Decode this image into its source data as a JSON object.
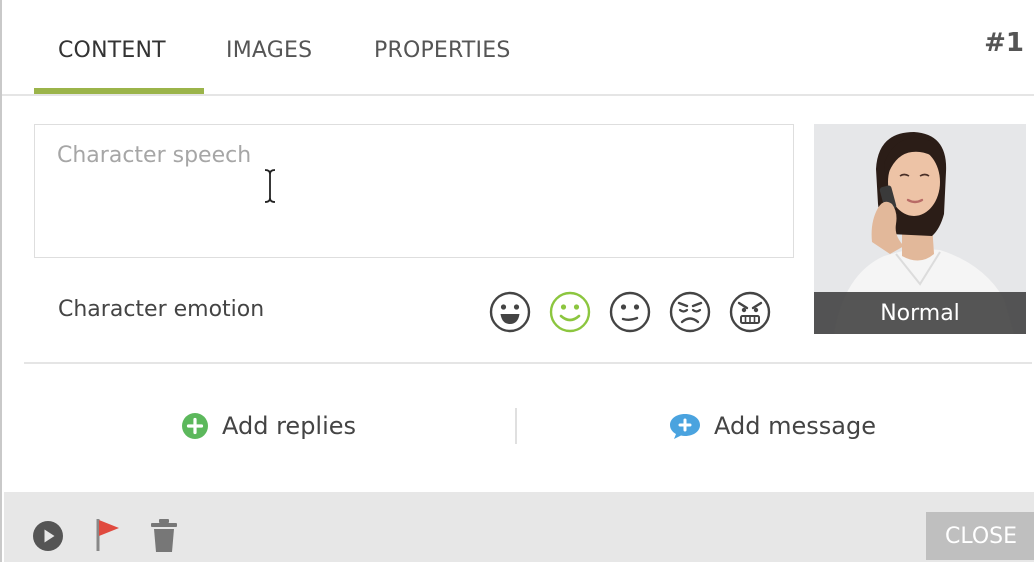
{
  "tabs": [
    {
      "label": "CONTENT",
      "active": true
    },
    {
      "label": "IMAGES",
      "active": false
    },
    {
      "label": "PROPERTIES",
      "active": false
    }
  ],
  "item_number": "#1",
  "speech": {
    "placeholder": "Character speech",
    "value": ""
  },
  "emotion": {
    "label": "Character emotion",
    "options": [
      "happy",
      "smile",
      "neutral",
      "sad",
      "angry"
    ],
    "selected": "smile",
    "selected_color": "#8cc63f",
    "default_color": "#444444"
  },
  "character": {
    "caption": "Normal"
  },
  "actions": {
    "add_replies": "Add replies",
    "add_message": "Add message"
  },
  "colors": {
    "accent": "#9bb44a",
    "add_replies_icon": "#5cb85c",
    "add_message_icon": "#4aa3df",
    "flag": "#e04a3f"
  },
  "footer": {
    "icons": [
      "play-icon",
      "flag-icon",
      "trash-icon"
    ],
    "close_label": "CLOSE"
  }
}
